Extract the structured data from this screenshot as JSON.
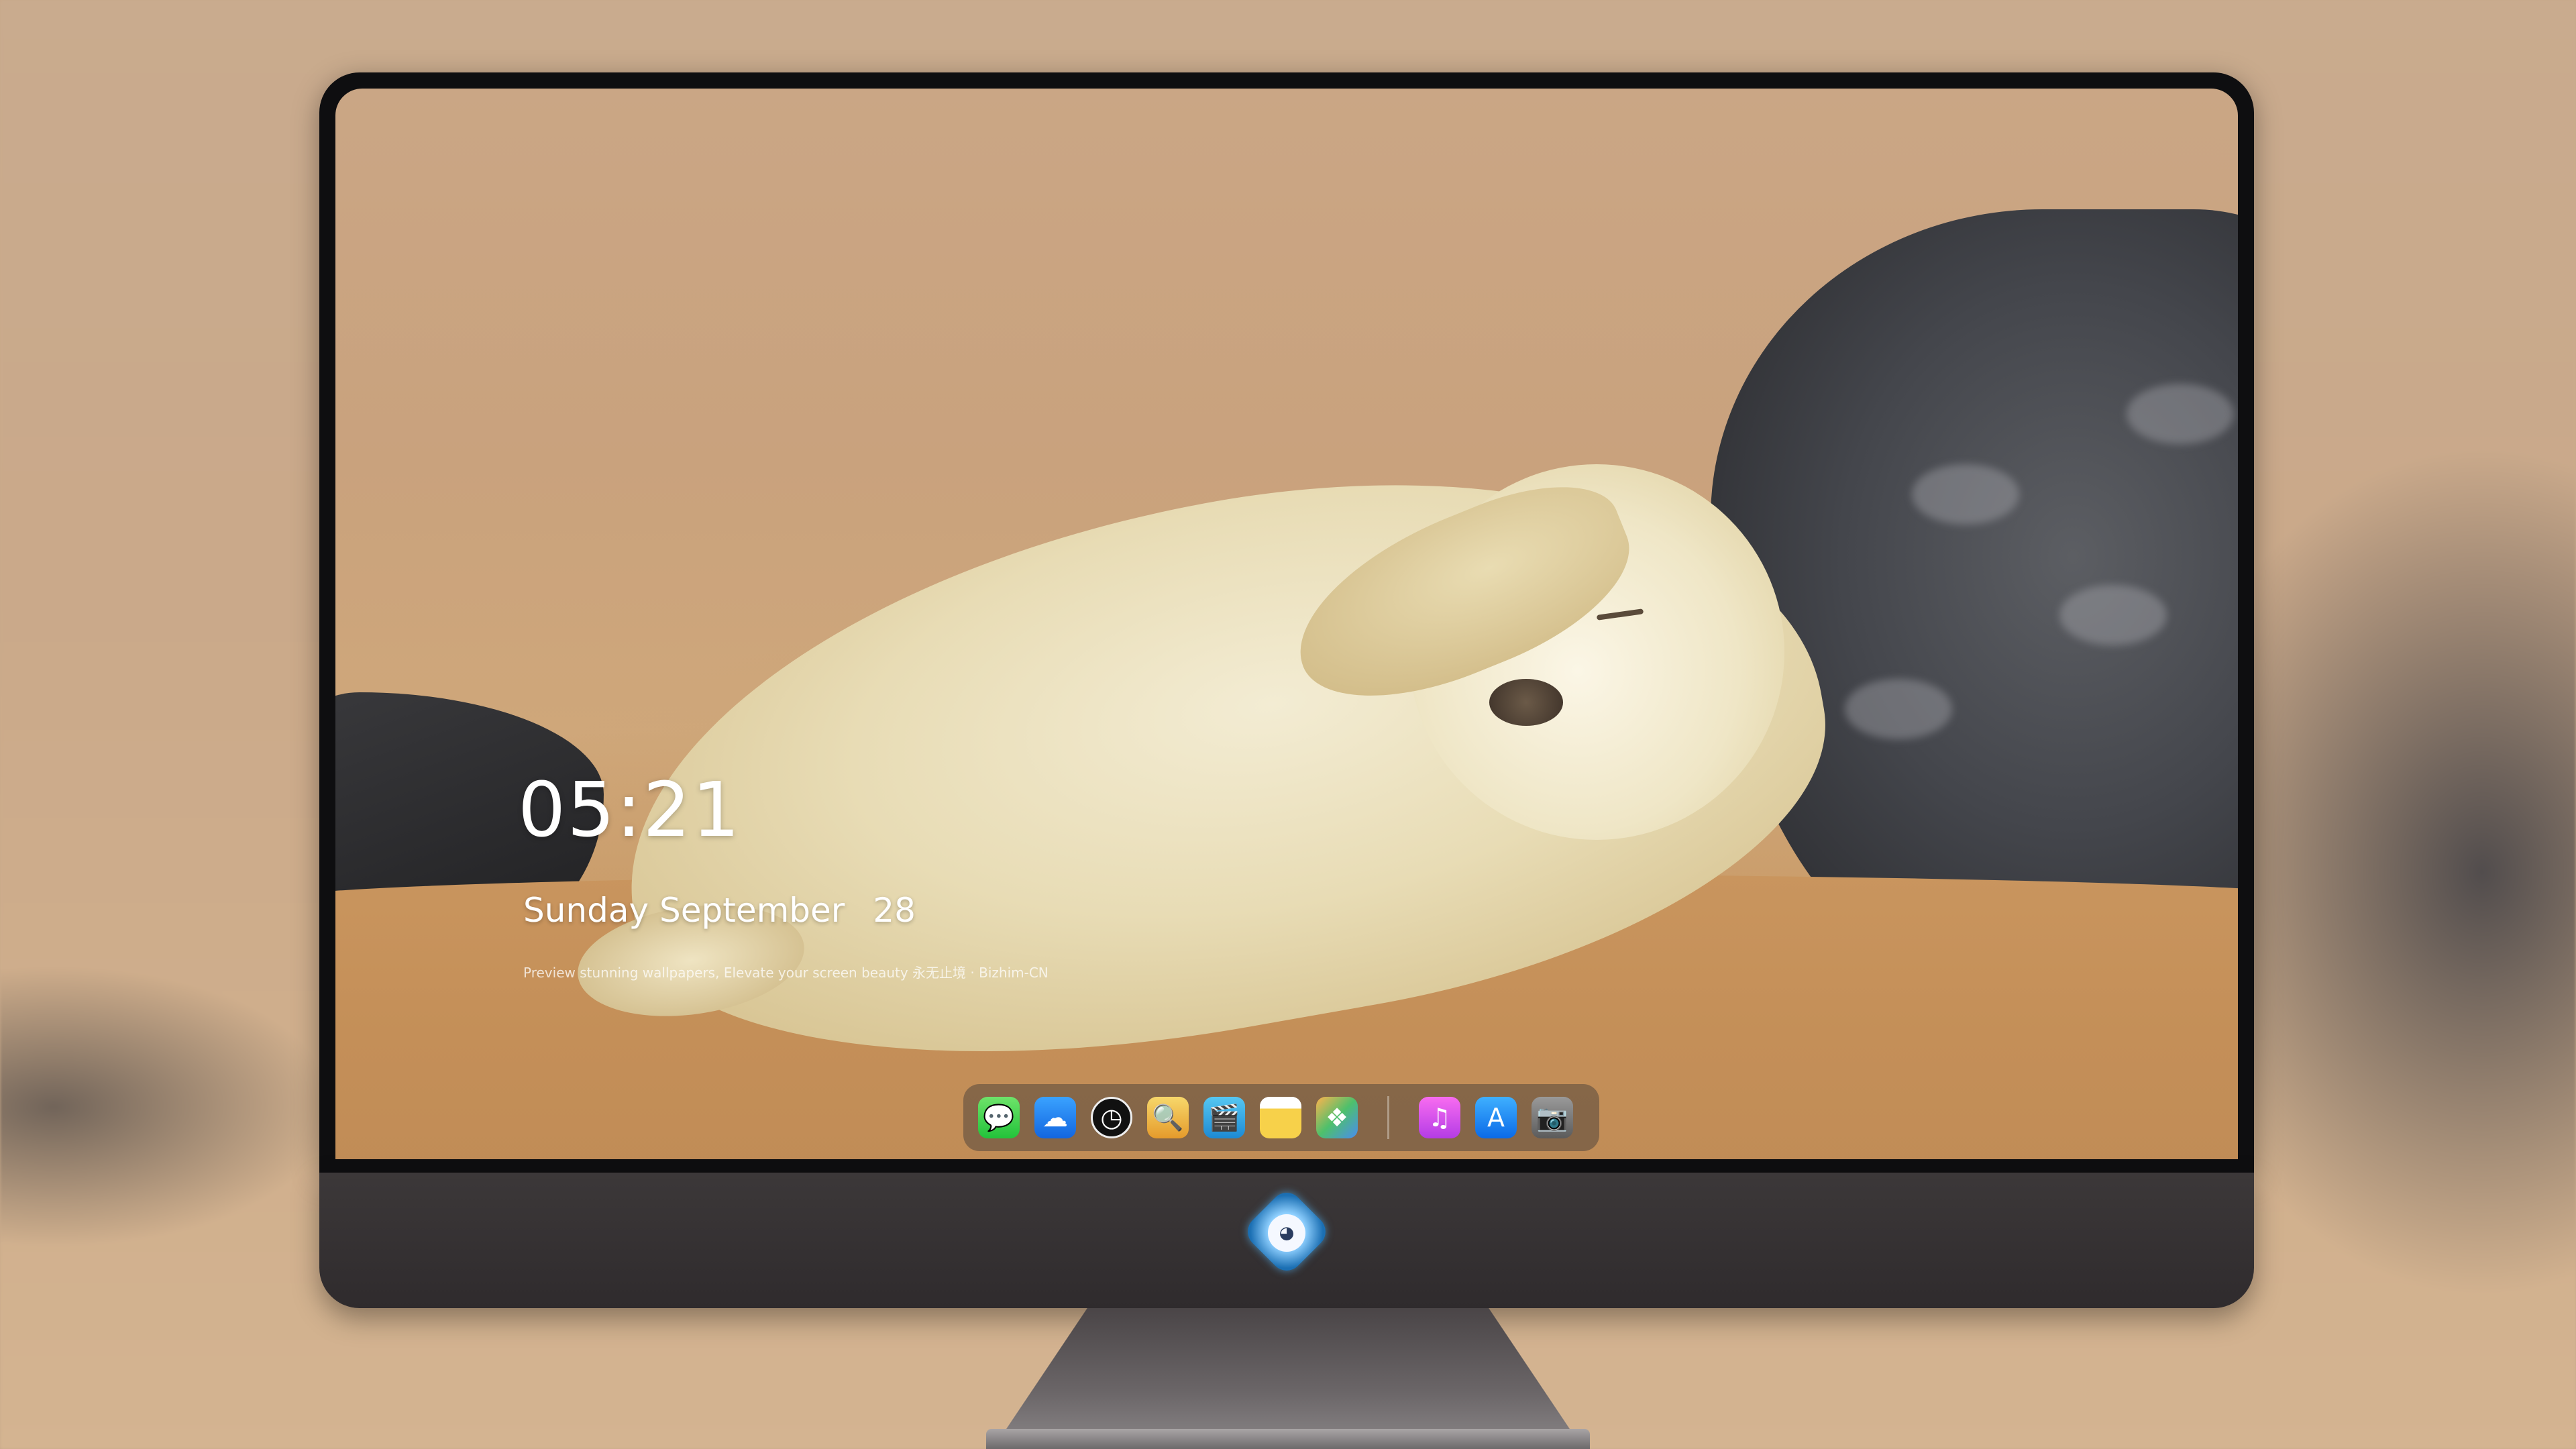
{
  "lock_screen": {
    "time": "05:21",
    "weekday": "Sunday",
    "month": "September",
    "day": "28",
    "caption": "Preview stunning wallpapers, Elevate your screen beauty  永无止境 · Bizhim-CN"
  },
  "dock": {
    "apps": [
      {
        "name": "Messages",
        "icon": "message-bubble-icon",
        "glyph": "💬"
      },
      {
        "name": "Weather",
        "icon": "cloud-sun-icon",
        "glyph": "☁"
      },
      {
        "name": "Clock",
        "icon": "clock-icon",
        "glyph": "◷"
      },
      {
        "name": "Preview",
        "icon": "preview-icon",
        "glyph": "🔍"
      },
      {
        "name": "Clips",
        "icon": "clapperboard-icon",
        "glyph": "🎬"
      },
      {
        "name": "Notes",
        "icon": "notes-icon",
        "glyph": ""
      },
      {
        "name": "Photos",
        "icon": "photos-icon",
        "glyph": "❖"
      },
      {
        "name": "Music",
        "icon": "music-note-icon",
        "glyph": "♫"
      },
      {
        "name": "App Store",
        "icon": "app-store-icon",
        "glyph": "A"
      },
      {
        "name": "Camera",
        "icon": "camera-icon",
        "glyph": "📷"
      }
    ]
  },
  "colors": {
    "dock_bg": "#3c3737",
    "chin": "#2f2b2d",
    "bezel": "#0e0e10"
  }
}
